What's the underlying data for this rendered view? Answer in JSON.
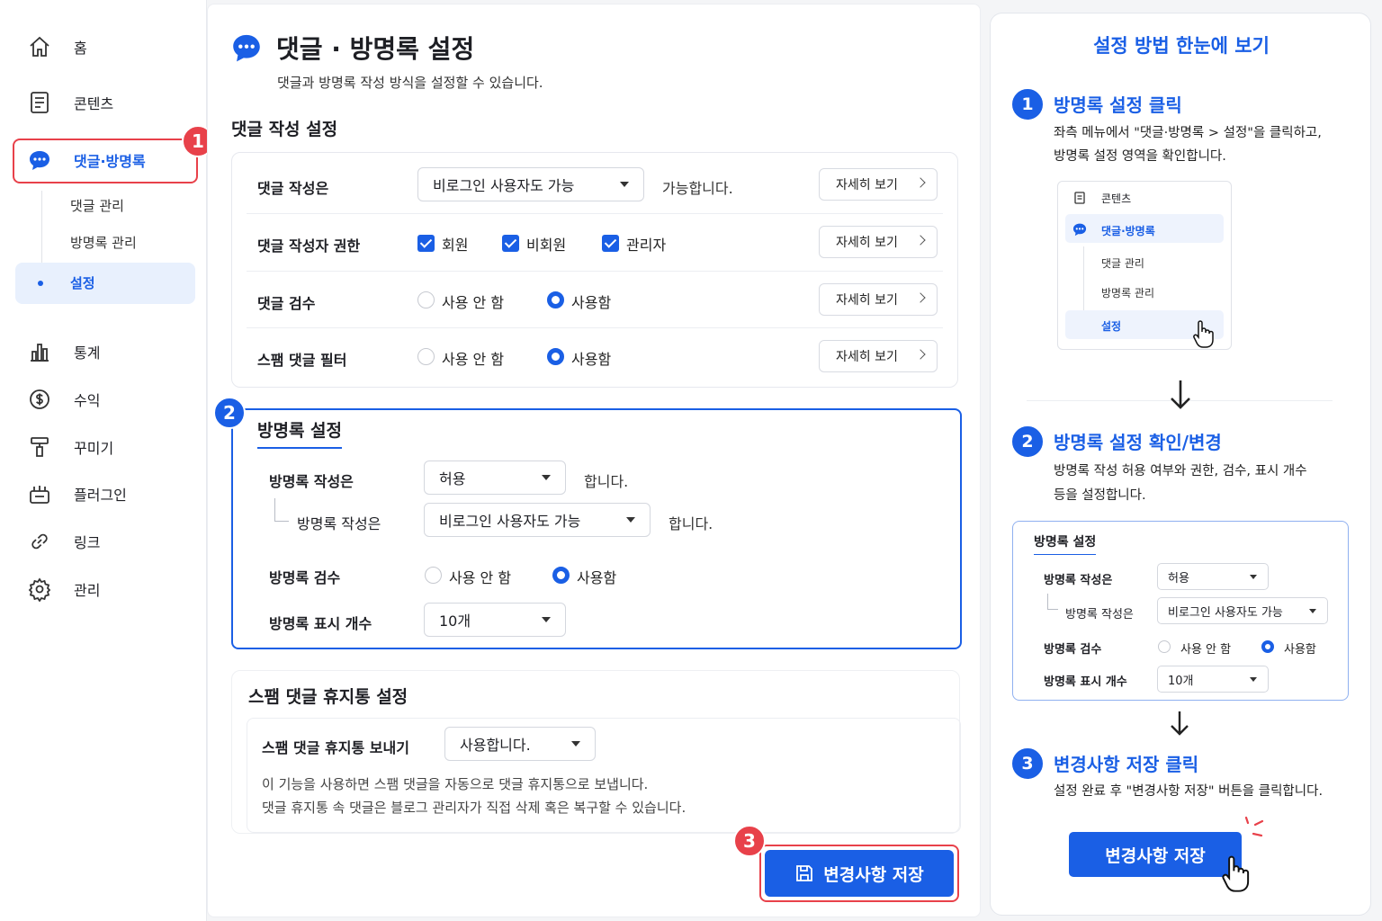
{
  "sidebar": {
    "items": [
      {
        "label": "홈",
        "icon": "home-icon"
      },
      {
        "label": "콘텐츠",
        "icon": "document-icon"
      },
      {
        "label": "댓글·방명록",
        "icon": "chat-bubble-icon"
      },
      {
        "label": "통계",
        "icon": "bar-chart-icon"
      },
      {
        "label": "수익",
        "icon": "dollar-icon"
      },
      {
        "label": "꾸미기",
        "icon": "paint-roller-icon"
      },
      {
        "label": "플러그인",
        "icon": "plugin-icon"
      },
      {
        "label": "링크",
        "icon": "link-icon"
      },
      {
        "label": "관리",
        "icon": "gear-icon"
      }
    ],
    "subitems": [
      "댓글 관리",
      "방명록 관리",
      "설정"
    ]
  },
  "header": {
    "title": "댓글 · 방명록 설정",
    "subtitle": "댓글과 방명록 작성 방식을 설정할 수 있습니다."
  },
  "comment_settings": {
    "section_title": "댓글 작성 설정",
    "rows": [
      {
        "label": "댓글 작성은",
        "select": "비로그인 사용자도 가능",
        "suffix": "가능합니다.",
        "more": "자세히 보기"
      },
      {
        "label": "댓글 작성자 권한",
        "checks": [
          "회원",
          "비회원",
          "관리자"
        ],
        "more": "자세히 보기"
      },
      {
        "label": "댓글 검수",
        "options": [
          "사용 안 함",
          "사용함"
        ],
        "more": "자세히 보기"
      },
      {
        "label": "스팸 댓글 필터",
        "options": [
          "사용 안 함",
          "사용함"
        ],
        "more": "자세히 보기"
      }
    ]
  },
  "guestbook": {
    "section_title": "방명록 설정",
    "write_label": "방명록 작성은",
    "write_value": "허용",
    "write_suffix": "합니다.",
    "sub_write_label": "방명록 작성은",
    "sub_write_value": "비로그인 사용자도 가능",
    "sub_write_suffix": "합니다.",
    "review_label": "방명록 검수",
    "review_options": [
      "사용 안 함",
      "사용함"
    ],
    "count_label": "방명록 표시 개수",
    "count_value": "10개"
  },
  "spam": {
    "section_title": "스팸 댓글 휴지통 설정",
    "label": "스팸 댓글 휴지통 보내기",
    "value": "사용합니다.",
    "desc1": "이 기능을 사용하면 스팸 댓글을 자동으로 댓글 휴지통으로 보냅니다.",
    "desc2": "댓글 휴지통 속 댓글은 블로그 관리자가 직접 삭제 혹은 복구할 수 있습니다."
  },
  "save_label": "변경사항 저장",
  "badges": [
    "1",
    "2",
    "3"
  ],
  "guide": {
    "title": "설정 방법 한눈에 보기",
    "steps": [
      {
        "num": "1",
        "title": "방명록 설정 클릭",
        "text1": "좌측 메뉴에서 \"댓글·방명록 > 설정\"을 클릭하고,",
        "text2": "방명록 설정 영역을 확인합니다."
      },
      {
        "num": "2",
        "title": "방명록 설정 확인/변경",
        "text1": "방명록 작성 허용 여부와 권한, 검수, 표시 개수",
        "text2": "등을 설정합니다."
      },
      {
        "num": "3",
        "title": "변경사항 저장 클릭",
        "text1": "설정 완료 후 \"변경사항 저장\" 버튼을 클릭합니다.",
        "text2": ""
      }
    ],
    "mini_menu": [
      "콘텐츠",
      "댓글·방명록",
      "댓글 관리",
      "방명록 관리",
      "설정"
    ],
    "mini_form": {
      "title": "방명록 설정",
      "write_label": "방명록 작성은",
      "write_value": "허용",
      "sub_write_label": "방명록 작성은",
      "sub_write_value": "비로그인 사용자도 가능",
      "review_label": "방명록 검수",
      "options": [
        "사용 안 함",
        "사용함"
      ],
      "count_label": "방명록 표시 개수",
      "count_value": "10개"
    },
    "save_label": "변경사항 저장"
  },
  "colors": {
    "accent": "#1a5fe5",
    "highlight": "#e8414a",
    "selected_bg": "#e8f0fd"
  }
}
